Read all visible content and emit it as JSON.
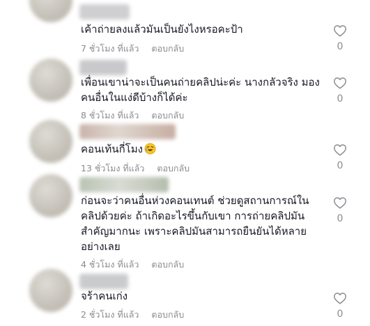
{
  "comments": [
    {
      "text": "เค้าถ่ายลงแล้วมันเป็นยังไงหรอคะป้า",
      "time": "7 ชั่วโมง ที่แล้ว",
      "reply_label": "ตอบกลับ",
      "likes": "0"
    },
    {
      "text": "เพื่อนเขาน่าจะเป็นคนถ่ายคลิปน่ะค่ะ นางกลัวจริง มองคนอื่นในแง่ดีบ้างก็ได้ค่ะ",
      "lines": [
        "เพื่อนเขาน่าจะเป็นคนถ่ายคลิปน่ะค่ะ นางกลัวจริง มอง",
        "คนอื่นในแง่ดีบ้างก็ได้ค่ะ"
      ],
      "time": "8 ชั่วโมง ที่แล้ว",
      "reply_label": "ตอบกลับ",
      "likes": "0"
    },
    {
      "text": "คอนเท้นกี่โมง",
      "emoji": "rolling-on-floor-laughing-emoji",
      "time": "13 ชั่วโมง ที่แล้ว",
      "reply_label": "ตอบกลับ",
      "likes": "0"
    },
    {
      "text": "ก่อนจะว่าคนอื่นห่วงคอนเทนต์ ช่วยดูสถานการณ์ในคลิปด้วยค่ะ ถ้าเกิดอะไรขึ้นกับเขา การถ่ายคลิปมันสำคัญมากนะ เพราะคลิปมันสามารถยืนยันได้หลายอย่างเลย",
      "lines": [
        "ก่อนจะว่าคนอื่นห่วงคอนเทนต์ ช่วยดูสถานการณ์ใน",
        "คลิปด้วยค่ะ ถ้าเกิดอะไรขึ้นกับเขา การถ่ายคลิปมัน",
        "สำคัญมากนะ เพราะคลิปมันสามารถยืนยันได้หลาย",
        "อย่างเลย"
      ],
      "time": "4 ชั่วโมง ที่แล้ว",
      "reply_label": "ตอบกลับ",
      "likes": "0"
    },
    {
      "text": "จร้าคนเก่ง",
      "time": "2 ชั่วโมง ที่แล้ว",
      "reply_label": "ตอบกลับ",
      "likes": "0"
    }
  ],
  "icons": {
    "like": "heart-outline-icon"
  },
  "colors": {
    "text": "#161823",
    "meta": "#8a8b91",
    "heart_stroke": "#8a8b91"
  }
}
